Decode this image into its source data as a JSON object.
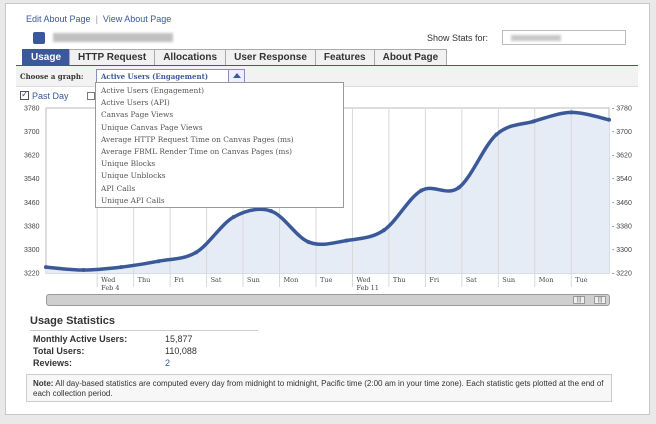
{
  "links": {
    "edit": "Edit About Page",
    "view": "View About Page",
    "separator": "|"
  },
  "header": {
    "show_stats_label": "Show Stats for:"
  },
  "tabs": [
    {
      "label": "Usage",
      "active": true
    },
    {
      "label": "HTTP Request",
      "active": false
    },
    {
      "label": "Allocations",
      "active": false
    },
    {
      "label": "User Response",
      "active": false
    },
    {
      "label": "Features",
      "active": false
    },
    {
      "label": "About Page",
      "active": false
    }
  ],
  "graph_select": {
    "label": "Choose a graph:",
    "selected": "Active Users (Engagement)",
    "options": [
      "Active Users (Engagement)",
      "Active Users (API)",
      "Canvas Page Views",
      "Unique Canvas Page Views",
      "Average HTTP Request Time on Canvas Pages (ms)",
      "Average FBML Render Time on Canvas Pages (ms)",
      "Unique Blocks",
      "Unique Unblocks",
      "API Calls",
      "Unique API Calls"
    ]
  },
  "past_day_label": "Past Day",
  "chart_data": {
    "type": "area",
    "y_ticks": [
      3220,
      3300,
      3380,
      3460,
      3540,
      3620,
      3700,
      3780
    ],
    "ylim": [
      3220,
      3780
    ],
    "grid": "vertical",
    "x": [
      "Tue",
      "Wed Feb 4",
      "Thu",
      "Fri",
      "Sat",
      "Sun",
      "Mon",
      "Tue",
      "Wed Feb 11",
      "Thu",
      "Fri",
      "Sat",
      "Sun",
      "Mon",
      "Tue"
    ],
    "x_tick_labels": [
      {
        "top": "Wed",
        "bottom": "Feb 4"
      },
      {
        "top": "Thu"
      },
      {
        "top": "Fri"
      },
      {
        "top": "Sat"
      },
      {
        "top": "Sun"
      },
      {
        "top": "Mon"
      },
      {
        "top": "Tue"
      },
      {
        "top": "Wed",
        "bottom": "Feb 11"
      },
      {
        "top": "Thu"
      },
      {
        "top": "Fri"
      },
      {
        "top": "Sat"
      },
      {
        "top": "Sun"
      },
      {
        "top": "Mon"
      },
      {
        "top": "Tue"
      }
    ],
    "values": [
      3240,
      3230,
      3240,
      3260,
      3290,
      3410,
      3430,
      3325,
      3330,
      3365,
      3500,
      3510,
      3690,
      3735,
      3765,
      3740
    ]
  },
  "usage_stats": {
    "title": "Usage Statistics",
    "rows": [
      {
        "label": "Monthly Active Users:",
        "value": "15,877"
      },
      {
        "label": "Total Users:",
        "value": "110,088"
      },
      {
        "label": "Reviews:",
        "value": "2"
      }
    ]
  },
  "note": {
    "bold": "Note:",
    "text": " All day-based statistics are computed every day from midnight to midnight, Pacific time (2:00 am in your time zone). Each statistic gets plotted at the end of each collection period."
  },
  "colors": {
    "line": "#3b5998",
    "fill": "#e6ecf5",
    "accent": "#3b5998"
  },
  "icons": {
    "app": "app-icon"
  }
}
